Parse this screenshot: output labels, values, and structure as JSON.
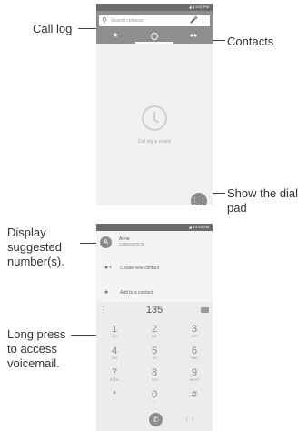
{
  "callouts": {
    "call_log": "Call log",
    "contacts": "Contacts",
    "show_dial_pad_line1": "Show the dial",
    "show_dial_pad_line2": "pad",
    "display_suggested_line1": "Display",
    "display_suggested_line2": "suggested",
    "display_suggested_line3": "number(s).",
    "long_press_line1": "Long press",
    "long_press_line2": "to access",
    "long_press_line3": "voicemail."
  },
  "phone1": {
    "status_time": "3:57 PM",
    "search_placeholder": "Search contacts",
    "empty_text": "Call log is empty",
    "icons": {
      "search": "search-icon",
      "mic": "mic-icon",
      "more": "more-vert-icon",
      "favorites": "star-icon",
      "call_log": "clock-icon",
      "contacts": "people-icon",
      "dialpad": "dialpad-icon"
    }
  },
  "phone2": {
    "status_time": "4:03 PM",
    "suggestion": {
      "initial": "A",
      "name": "Anne",
      "number": "13853437678"
    },
    "actions": [
      "Create new contact",
      "Add to a contact"
    ],
    "dialed": "135",
    "keys": [
      {
        "n": "1",
        "l": "QO"
      },
      {
        "n": "2",
        "l": "ABC"
      },
      {
        "n": "3",
        "l": "DEF"
      },
      {
        "n": "4",
        "l": "GHI"
      },
      {
        "n": "5",
        "l": "JKL"
      },
      {
        "n": "6",
        "l": "MNO"
      },
      {
        "n": "7",
        "l": "PQRS"
      },
      {
        "n": "8",
        "l": "TUV"
      },
      {
        "n": "9",
        "l": "WXYZ"
      },
      {
        "n": "*",
        "l": ""
      },
      {
        "n": "0",
        "l": "+"
      },
      {
        "n": "#",
        "l": ""
      }
    ],
    "colors": {
      "accent": "#8c8c8c",
      "pad_bg": "#ececec"
    }
  }
}
